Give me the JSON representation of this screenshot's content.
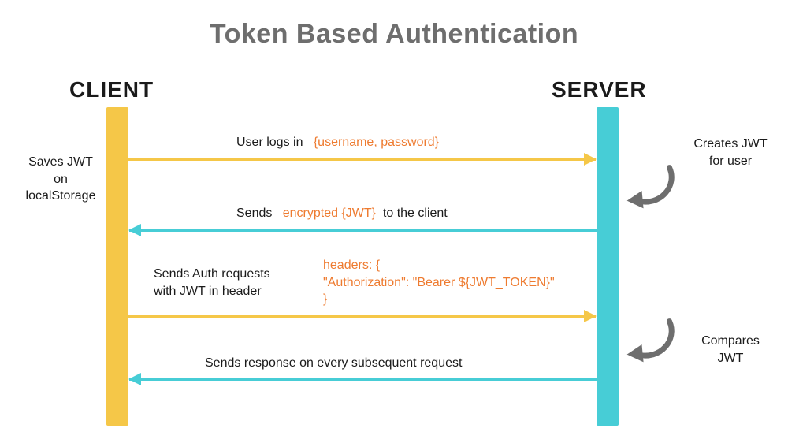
{
  "title": "Token Based Authentication",
  "actors": {
    "client": "CLIENT",
    "server": "SERVER"
  },
  "colors": {
    "client_lifeline": "#f5c748",
    "server_lifeline": "#47cdd6",
    "arrow_to_server": "#f5c748",
    "arrow_to_client": "#47cdd6",
    "highlight": "#ee7b30",
    "loop_arrow": "#6e6e6e"
  },
  "notes": {
    "client_save": "Saves JWT\non\nlocalStorage",
    "server_create": "Creates JWT\nfor user",
    "server_compare": "Compares\nJWT"
  },
  "messages": {
    "m1": {
      "text_plain": "User logs in",
      "text_highlight": "{username, password}"
    },
    "m2": {
      "text_plain_pre": "Sends",
      "text_highlight": "encrypted {JWT}",
      "text_plain_post": "to the client"
    },
    "m3": {
      "text_plain_line1": "Sends Auth requests",
      "text_plain_line2": "with JWT in header",
      "code_line1": "headers: {",
      "code_line2": "\"Authorization\": \"Bearer ${JWT_TOKEN}\"",
      "code_line3": "}"
    },
    "m4": {
      "text_plain": "Sends response on every subsequent request"
    }
  }
}
